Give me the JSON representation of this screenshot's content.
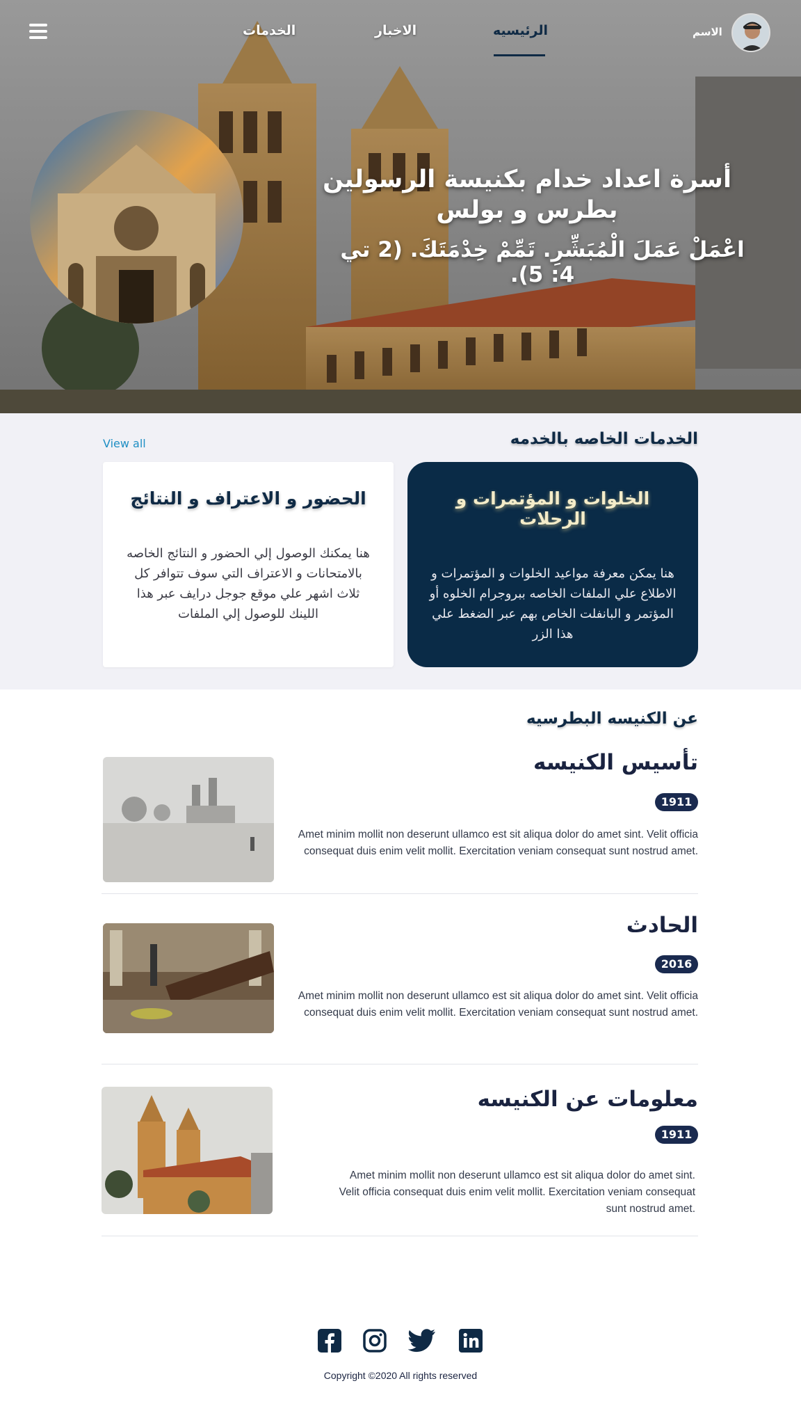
{
  "nav": {
    "links": [
      "الخدمات",
      "الاخبار",
      "الرئيسيه"
    ],
    "active_link": "الرئيسيه",
    "user_name": "الاسم"
  },
  "hero": {
    "title": "أسرة اعداد خدام بكنيسة الرسولين بطرس و بولس",
    "verse": "اعْمَلْ عَمَلَ الْمُبَشِّرِ. تَمِّمْ خِدْمَتَكَ. (2 تي 4: 5)."
  },
  "services": {
    "title": "الخدمات الخاصه بالخدمه",
    "view_all": "View all",
    "cards": [
      {
        "title": "الخلوات و المؤتمرات و الرحلات",
        "text": "هنا يمكن معرفة مواعيد الخلوات و المؤتمرات و الاطلاع علي الملفات الخاصه ببروجرام الخلوه أو المؤتمر و البانفلت الخاص بهم عبر الضغط علي هذا الزر"
      },
      {
        "title": "الحضور و الاعتراف و النتائج",
        "text": "هنا يمكنك الوصول إلي الحضور و النتائج الخاصه بالامتحانات و الاعتراف التي سوف تتوافر كل ثلاث اشهر علي موقع جوجل درايف عبر هذا اللينك للوصول إلي الملفات"
      }
    ]
  },
  "about": {
    "title": "عن الكنيسه البطرسيه",
    "items": [
      {
        "title": "تأسيس الكنيسه",
        "year": "1911",
        "text": "Amet minim mollit non deserunt ullamco est sit aliqua dolor do amet sint. Velit officia consequat duis enim velit mollit. Exercitation veniam consequat sunt nostrud amet."
      },
      {
        "title": "الحادث",
        "year": "2016",
        "text": "Amet minim mollit non deserunt ullamco est sit aliqua dolor do amet sint. Velit officia consequat duis enim velit mollit. Exercitation veniam consequat sunt nostrud amet."
      },
      {
        "title": "معلومات عن الكنيسه",
        "year": "1911",
        "text": "Amet minim mollit non deserunt ullamco est sit aliqua dolor do amet sint. Velit officia consequat duis enim velit mollit. Exercitation veniam consequat sunt nostrud amet."
      }
    ]
  },
  "footer": {
    "social_icons": [
      "facebook-icon",
      "instagram-icon",
      "twitter-icon",
      "linkedin-icon"
    ],
    "copyright": "Copyright ©2020 All rights reserved"
  },
  "colors": {
    "primary_dark": "#0a2b47",
    "badge": "#1a2a4f",
    "link": "#1f8fc4",
    "section_bg": "#f1f1f6"
  }
}
